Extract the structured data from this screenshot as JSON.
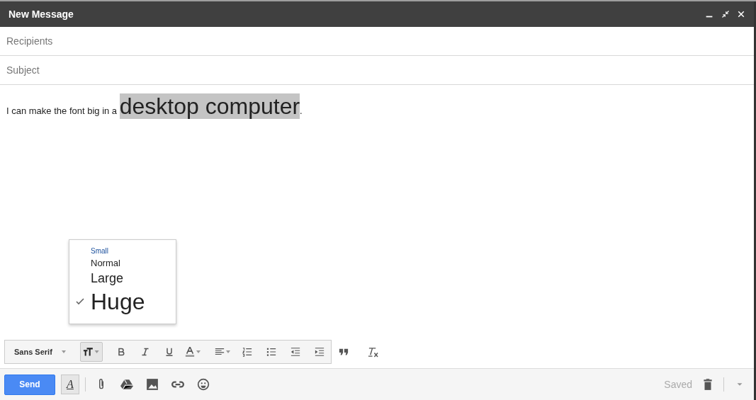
{
  "window": {
    "title": "New Message"
  },
  "recipients": {
    "placeholder": "Recipients"
  },
  "subject": {
    "placeholder": "Subject"
  },
  "body": [
    {
      "text": "I can make the font big in a ",
      "kind": "normal",
      "selected": false
    },
    {
      "text": "desktop computer",
      "kind": "huge",
      "selected": true
    },
    {
      "text": ".",
      "kind": "normal",
      "selected": false
    }
  ],
  "size_menu": [
    {
      "label": "Small",
      "kind": "small",
      "selected": false
    },
    {
      "label": "Normal",
      "kind": "normal",
      "selected": false
    },
    {
      "label": "Large",
      "kind": "large",
      "selected": false
    },
    {
      "label": "Huge",
      "kind": "huge",
      "selected": true
    }
  ],
  "format_toolbar": {
    "font": "Sans Serif",
    "size_menu_open": true
  },
  "bottom_bar": {
    "send": "Send",
    "formatting_label": "A",
    "formatting_on": true,
    "status": "Saved"
  }
}
